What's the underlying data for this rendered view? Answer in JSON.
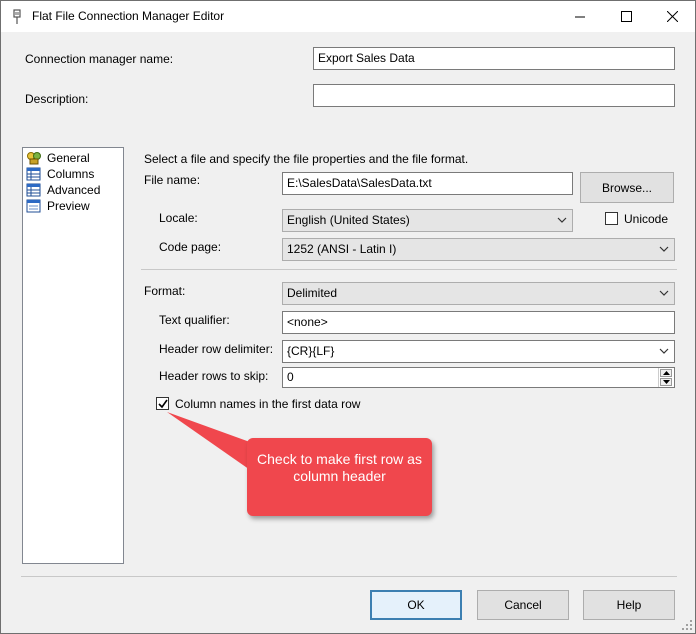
{
  "window": {
    "title": "Flat File Connection Manager Editor"
  },
  "top": {
    "conn_name_label": "Connection manager name:",
    "conn_name_value": "Export Sales Data",
    "description_label": "Description:",
    "description_value": ""
  },
  "nav": {
    "items": [
      {
        "label": "General",
        "icon": "general-icon"
      },
      {
        "label": "Columns",
        "icon": "grid-icon"
      },
      {
        "label": "Advanced",
        "icon": "grid-icon"
      },
      {
        "label": "Preview",
        "icon": "preview-icon"
      }
    ]
  },
  "general": {
    "intro": "Select a file and specify the file properties and the file format.",
    "file_name_label": "File name:",
    "file_name_value": "E:\\SalesData\\SalesData.txt",
    "browse_label": "Browse...",
    "locale_label": "Locale:",
    "locale_value": "English (United States)",
    "unicode_label": "Unicode",
    "unicode_checked": false,
    "code_page_label": "Code page:",
    "code_page_value": "1252  (ANSI - Latin I)",
    "format_label": "Format:",
    "format_value": "Delimited",
    "text_qualifier_label": "Text qualifier:",
    "text_qualifier_value": "<none>",
    "header_row_delim_label": "Header row delimiter:",
    "header_row_delim_value": "{CR}{LF}",
    "header_rows_skip_label": "Header rows to skip:",
    "header_rows_skip_value": "0",
    "col_names_label": "Column names in the first data row",
    "col_names_checked": true
  },
  "callout": {
    "text": "Check to make first row as column header",
    "color": "#f0474d"
  },
  "footer": {
    "ok_label": "OK",
    "cancel_label": "Cancel",
    "help_label": "Help"
  }
}
